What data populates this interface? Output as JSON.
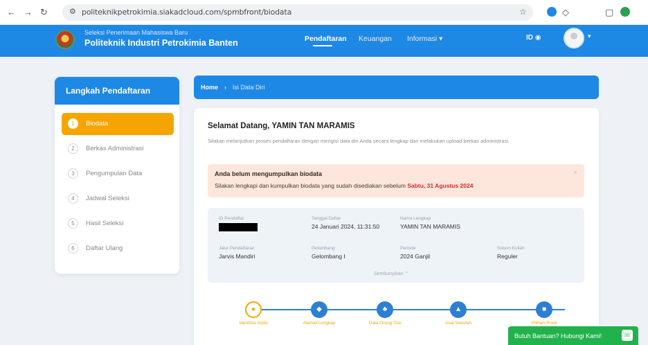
{
  "browser": {
    "url": "politeknikpetrokimia.siakadcloud.com/spmbfront/biodata",
    "back_icon": "←",
    "forward_icon": "→",
    "reload_icon": "↻",
    "site_info_icon": "⚙",
    "bookmark_icon": "☆",
    "extensions_icon": "◇",
    "sidebar_icon": "▢"
  },
  "header": {
    "institution_subtitle": "Seleksi Penerimaan Mahasiswa Baru",
    "institution_title": "Politeknik Industri Petrokimia Banten",
    "nav": [
      {
        "label": "Pendaftaran",
        "active": true
      },
      {
        "label": "Keuangan",
        "active": false
      },
      {
        "label": "Informasi",
        "active": false
      }
    ],
    "informasi_caret": "▾",
    "language": "ID",
    "language_icon": "◉",
    "avatar_caret": "▾"
  },
  "sidebar": {
    "title": "Langkah Pendaftaran",
    "steps": [
      {
        "num": "1",
        "label": "Biodata",
        "active": true
      },
      {
        "num": "2",
        "label": "Berkas Administrasi",
        "active": false
      },
      {
        "num": "3",
        "label": "Pengumpulan Data",
        "active": false
      },
      {
        "num": "4",
        "label": "Jadwal Seleksi",
        "active": false
      },
      {
        "num": "5",
        "label": "Hasil Seleksi",
        "active": false
      },
      {
        "num": "6",
        "label": "Daftar Ulang",
        "active": false
      }
    ]
  },
  "breadcrumb": {
    "home": "Home",
    "separator": "›",
    "current": "Isi Data Diri"
  },
  "main": {
    "welcome": "Selamat Datang, YAMIN TAN MARAMIS",
    "intro": "Silakan melanjutkan proses pendaftaran dengan mengisi data diri Anda secara lengkap dan melakukan upload berkas administrasi.",
    "alert": {
      "title": "Anda belum mengumpulkan biodata",
      "text": "Silakan lengkapi dan kumpulkan biodata yang sudah disediakan sebelum",
      "deadline": "Sabtu, 31 Agustus 2024",
      "close": "×"
    },
    "info": {
      "fields": [
        {
          "key": "ID Pendaftar",
          "value": ""
        },
        {
          "key": "Tanggal Daftar",
          "value": "24 Januari 2024, 11:31:50"
        },
        {
          "key": "Nama Lengkap",
          "value": "YAMIN TAN MARAMIS"
        },
        {
          "key": "Jalur Pendaftaran",
          "value": "Jarvis Mandiri"
        },
        {
          "key": "Gelombang",
          "value": "Gelombang I"
        },
        {
          "key": "Periode",
          "value": "2024 Ganjil"
        },
        {
          "key": "Sistem Kuliah",
          "value": "Reguler"
        }
      ],
      "toggle": "Sembunyikan ⌃"
    },
    "progress": [
      {
        "label": "Identitas Anda",
        "icon": "person-icon",
        "glyph": "●",
        "active": true
      },
      {
        "label": "Alamat Lengkap",
        "icon": "location-icon",
        "glyph": "◆",
        "active": false
      },
      {
        "label": "Data Orang Tua",
        "icon": "family-icon",
        "glyph": "♣",
        "active": false
      },
      {
        "label": "Asal Sekolah",
        "icon": "graduation-icon",
        "glyph": "▲",
        "active": false
      },
      {
        "label": "Pilihan Prodi",
        "icon": "book-icon",
        "glyph": "■",
        "active": false
      }
    ]
  },
  "help": {
    "label": "Butuh Bantuan? Hubungi Kami!",
    "icon": "☏"
  },
  "colors": {
    "primary": "#1e88e5",
    "accent": "#f6a500",
    "alert_bg": "#fde7dc",
    "deadline": "#d62828",
    "help": "#22b24c"
  }
}
